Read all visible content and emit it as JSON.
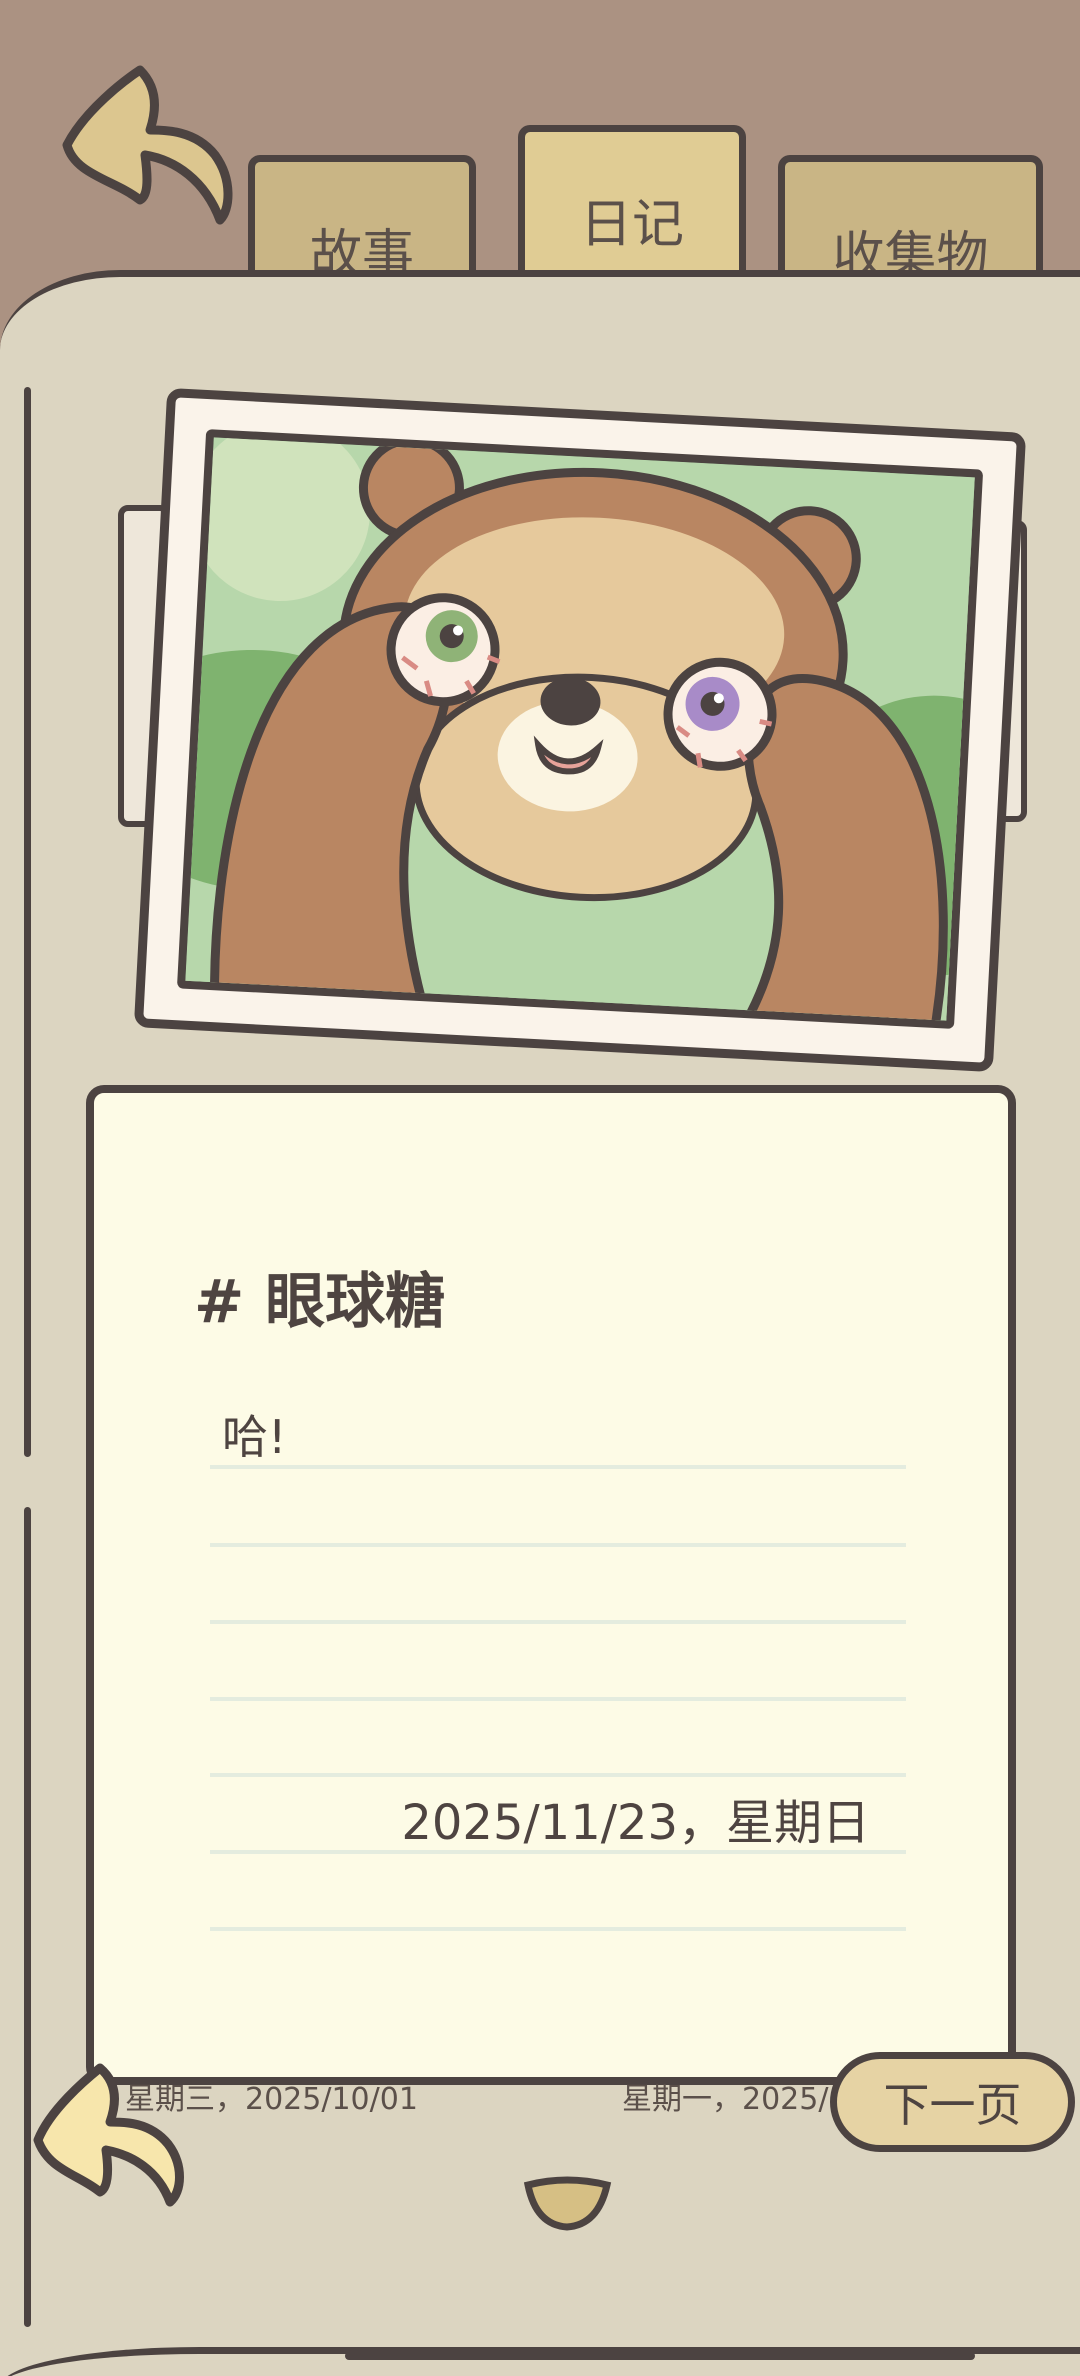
{
  "tabs": [
    {
      "label": "故事",
      "active": false
    },
    {
      "label": "日记",
      "active": true
    },
    {
      "label": "收集物",
      "active": false
    }
  ],
  "photo": {
    "subject": "bear-holding-eyeballs-icon"
  },
  "entry": {
    "title": "# 眼球糖",
    "text": "哈!",
    "date": "2025/11/23，星期日"
  },
  "footer": {
    "prev_date": "星期三，2025/10/01",
    "next_date": "星期一，2025/",
    "next_label": "下一页"
  },
  "colors": {
    "outline": "#4c4341",
    "paper": "#fdfbe6",
    "book": "#dcd5c1",
    "background": "#ab9282",
    "tab": "#c9b585",
    "accent": "#e6d3a4"
  }
}
